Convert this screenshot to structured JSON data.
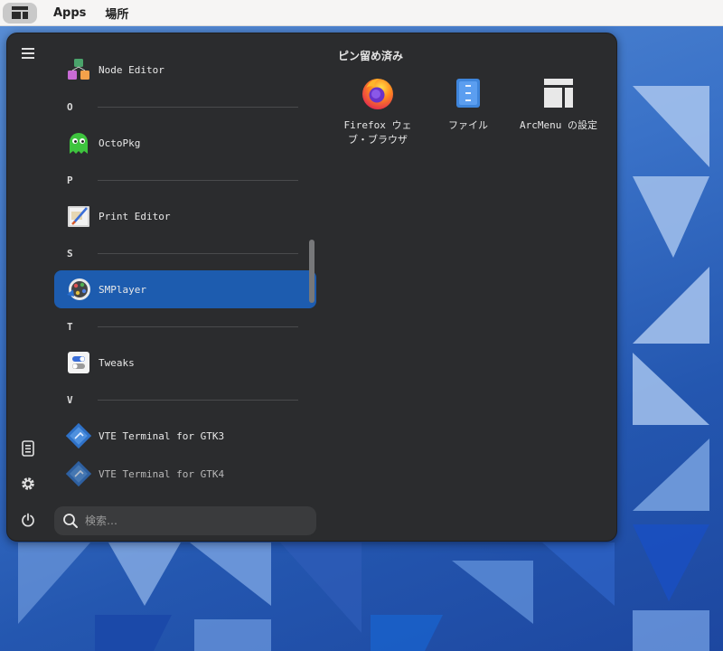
{
  "topbar": {
    "apps_label": "Apps",
    "places_label": "場所"
  },
  "menu": {
    "pinned_title": "ピン留め済み",
    "search_placeholder": "検索…",
    "app_rows": [
      {
        "label": "Node Editor",
        "icon": "node-editor-icon"
      },
      {
        "label": "OctoPkg",
        "icon": "octopkg-ghost-icon"
      },
      {
        "label": "Print Editor",
        "icon": "print-editor-icon"
      },
      {
        "label": "SMPlayer",
        "icon": "smplayer-icon",
        "selected": true
      },
      {
        "label": "Tweaks",
        "icon": "tweaks-icon"
      },
      {
        "label": "VTE Terminal for GTK3",
        "icon": "vte-terminal-icon"
      },
      {
        "label": "VTE Terminal for GTK4",
        "icon": "vte-terminal-icon"
      }
    ],
    "sections": [
      "O",
      "P",
      "S",
      "T",
      "V"
    ],
    "pinned": [
      {
        "label": "Firefox ウェブ・ブラウザ",
        "icon": "firefox-icon"
      },
      {
        "label": "ファイル",
        "icon": "files-icon"
      },
      {
        "label": "ArcMenu の設定",
        "icon": "arcmenu-settings-icon"
      }
    ]
  },
  "colors": {
    "menu_bg": "#2b2c2e",
    "selected": "#1d5caf",
    "topbar": "#f6f5f4"
  }
}
